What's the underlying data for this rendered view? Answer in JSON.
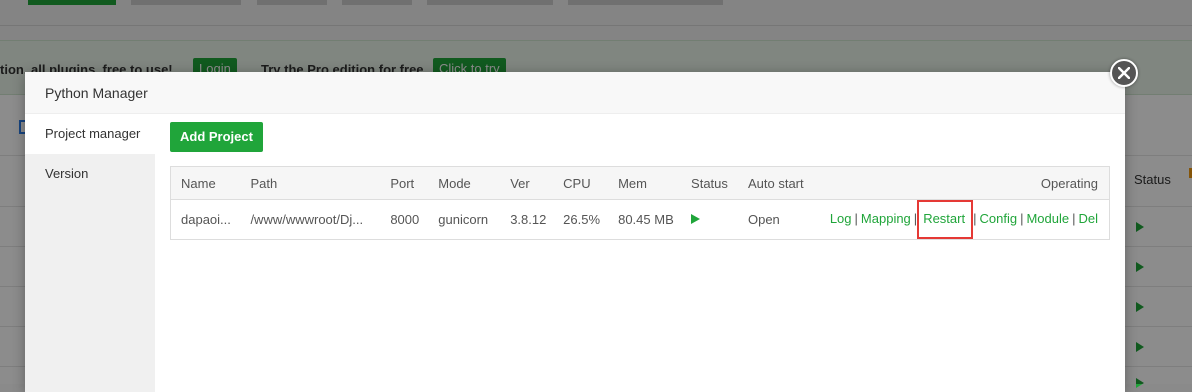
{
  "background": {
    "banner": {
      "text_left": "tion, all plugins, free to use!",
      "login_label": "Login",
      "text_right": "Try the Pro edition for free",
      "try_label": "Click to try"
    },
    "status_header": "Status"
  },
  "modal": {
    "title": "Python Manager",
    "nav": [
      {
        "label": "Project manager",
        "active": true
      },
      {
        "label": "Version",
        "active": false
      }
    ],
    "add_project_label": "Add Project",
    "table": {
      "headers": [
        "Name",
        "Path",
        "Port",
        "Mode",
        "Ver",
        "CPU",
        "Mem",
        "Status",
        "Auto start",
        "Operating"
      ],
      "rows": [
        {
          "name": "dapaoi...",
          "path": "/www/wwwroot/Dj...",
          "port": "8000",
          "mode": "gunicorn",
          "ver": "3.8.12",
          "cpu": "26.5%",
          "mem": "80.45 MB",
          "status_icon": "play-icon",
          "auto_start": "Open",
          "operations": [
            "Log",
            "Mapping",
            "Restart",
            "Config",
            "Module",
            "Del"
          ]
        }
      ]
    }
  },
  "colors": {
    "accent": "#20a53a",
    "highlight_box": "#e53935"
  }
}
